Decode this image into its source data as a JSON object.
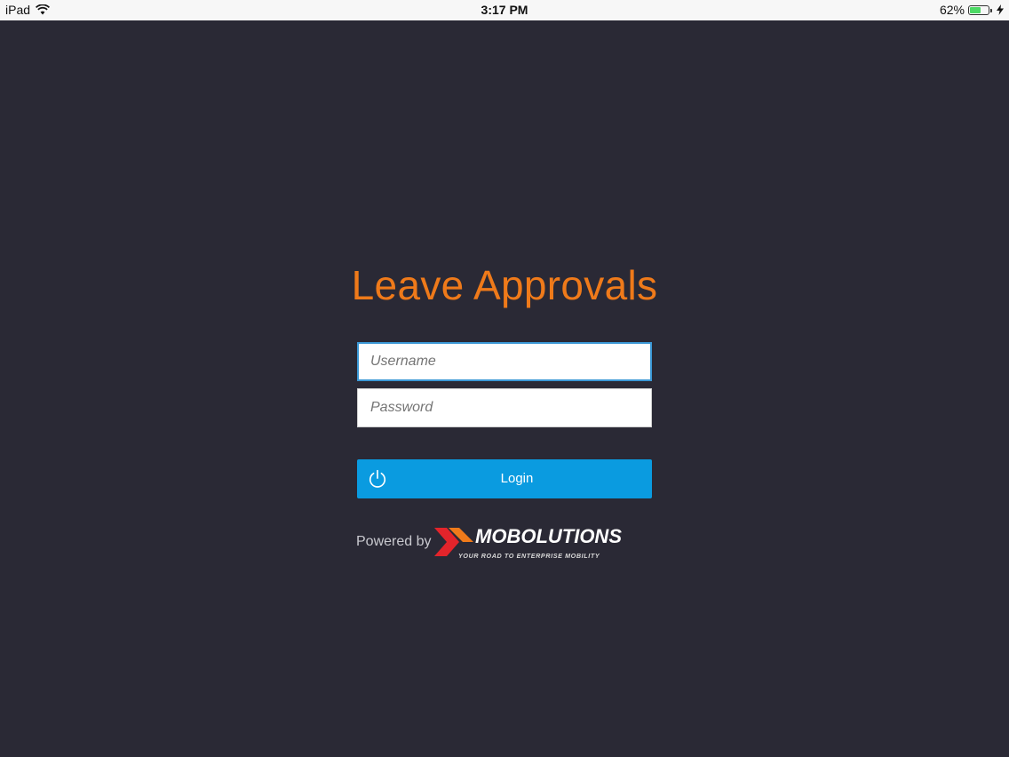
{
  "status_bar": {
    "device": "iPad",
    "time": "3:17 PM",
    "battery_percent": "62%",
    "battery_level": 0.62,
    "icons": [
      "wifi-icon",
      "battery-icon",
      "charging-bolt-icon"
    ]
  },
  "app": {
    "title": "Leave Approvals",
    "accent_color": "#ef7a1a",
    "background_color": "#2a2935"
  },
  "form": {
    "username_placeholder": "Username",
    "username_value": "",
    "password_placeholder": "Password",
    "password_value": "",
    "login_label": "Login",
    "login_icon": "power-icon",
    "button_color": "#0a9be0"
  },
  "footer": {
    "powered_by": "Powered by",
    "brand_name": "MOBOLUTIONS",
    "brand_tagline": "YOUR ROAD TO ENTERPRISE MOBILITY"
  }
}
